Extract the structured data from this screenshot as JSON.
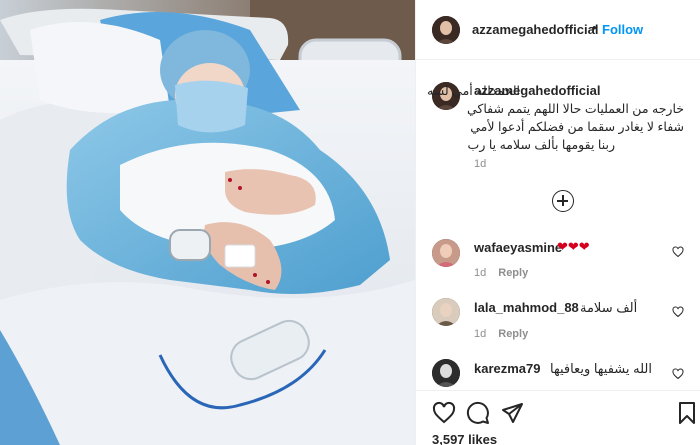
{
  "post": {
    "username": "azzamegahedofficial",
    "dot": "•",
    "follow_label": "Follow",
    "caption_lines": [
      "الحمدلله أمي لسه",
      "خارجه من العمليات حالا اللهم يتمم شفاكي",
      "شفاء لا يغادر سقما من فضلكم أدعوا لأمي",
      "ربنا يقومها بألف سلامه يا رب"
    ],
    "caption_time": "1d",
    "likes": "3,597 likes"
  },
  "comments": [
    {
      "username": "wafaeyasmine",
      "text": "❤❤❤",
      "time": "1d",
      "reply": "Reply"
    },
    {
      "username": "lala_mahmod_88",
      "text": "ألف سلامة",
      "time": "1d",
      "reply": "Reply"
    },
    {
      "username": "karezma79",
      "text": "الله يشفيها ويعافيها",
      "time": "",
      "reply": ""
    }
  ],
  "colors": {
    "link_blue": "#0095f6",
    "text": "#262626",
    "muted": "#8e8e8e",
    "heart_red": "#d6001c"
  },
  "icons": [
    "heart-icon",
    "comment-icon",
    "share-icon",
    "bookmark-icon",
    "add-comment-icon",
    "like-comment-icon"
  ]
}
